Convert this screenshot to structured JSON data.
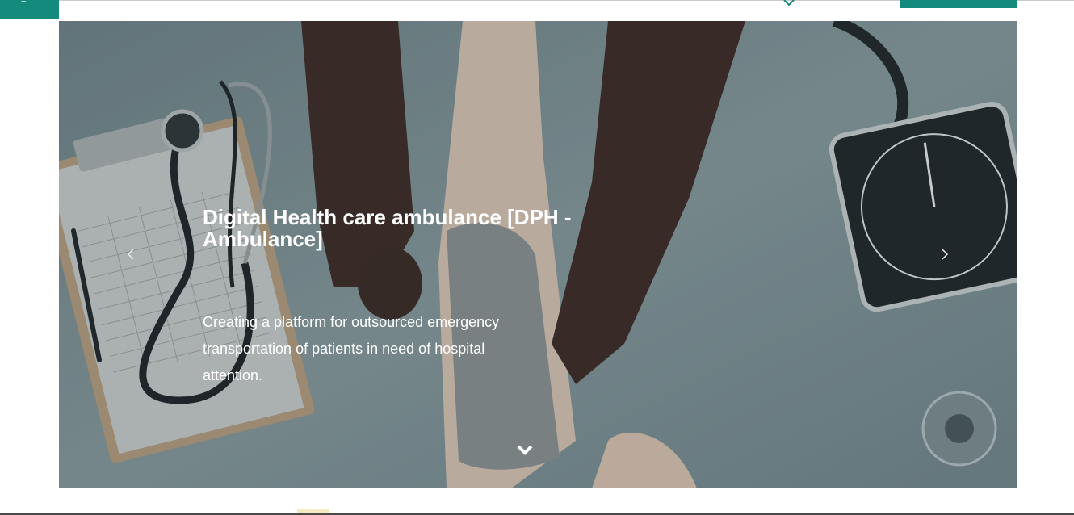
{
  "header": {
    "logo_mark": "≡"
  },
  "hero": {
    "title": "Digital Health care ambulance [DPH - Ambulance]",
    "description": "Creating a platform for outsourced emergency transportation of patients in need of hospital attention."
  },
  "colors": {
    "brand": "#138a7c",
    "text_on_image": "#ffffff"
  },
  "icons": {
    "prev": "chevron-left-icon",
    "next": "chevron-right-icon",
    "scroll": "chevron-down-icon",
    "nav": "chevron-down-icon"
  }
}
